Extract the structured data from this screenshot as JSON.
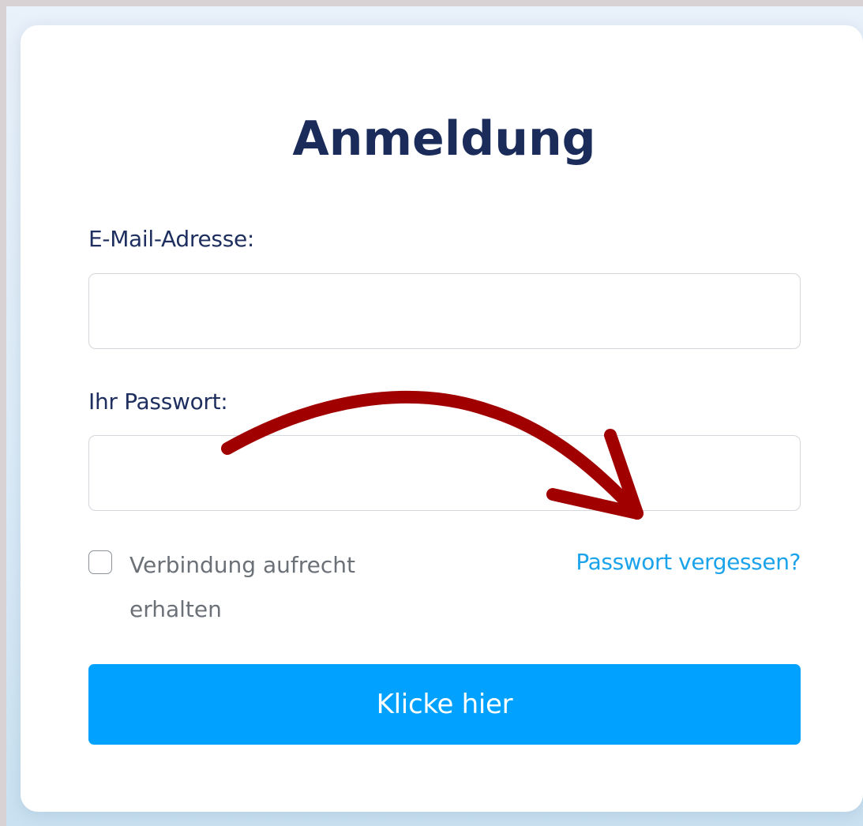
{
  "form": {
    "title": "Anmeldung",
    "email_label": "E-Mail-Adresse:",
    "email_value": "",
    "password_label": "Ihr Passwort:",
    "password_value": "",
    "remember_label": "Verbindung aufrecht erhalten",
    "remember_checked": false,
    "forgot_link": "Passwort vergessen?",
    "submit_label": "Klicke hier"
  },
  "annotation": {
    "arrow_color": "#a10000",
    "points_to": "forgot-password-link"
  },
  "colors": {
    "title": "#1b2c5a",
    "labels": "#1e2f5f",
    "link": "#1aa3ea",
    "button": "#01a2ff",
    "button_text": "#ffffff"
  }
}
